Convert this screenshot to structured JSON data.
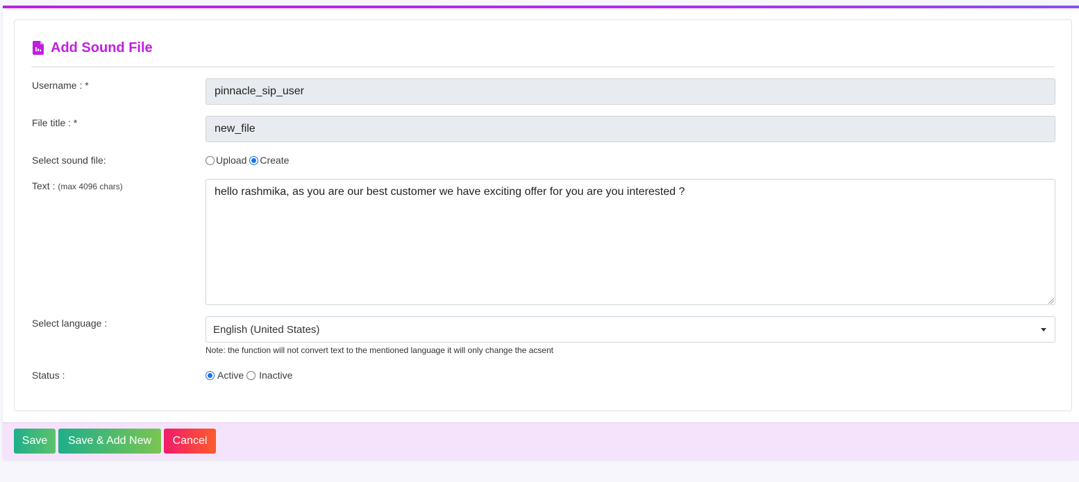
{
  "colors": {
    "accent": "#c11ee1",
    "footer_bg": "#f5e3fb",
    "save_btn": "#1fae8a",
    "cancel_btn": "#f01b6b",
    "radio": "#1a73e8"
  },
  "header": {
    "title": "Add Sound File",
    "icon": "audio-file-icon"
  },
  "form": {
    "username": {
      "label": "Username : *",
      "value": "pinnacle_sip_user"
    },
    "file_title": {
      "label": "File title : *",
      "value": "new_file"
    },
    "sound_file": {
      "label": "Select sound file:",
      "options": [
        {
          "label": "Upload",
          "checked": false
        },
        {
          "label": "Create",
          "checked": true
        }
      ]
    },
    "text": {
      "label": "Text : ",
      "hint": "(max 4096 chars)",
      "value": "hello rashmika, as you are our best customer we have exciting offer for you are you interested ?"
    },
    "language": {
      "label": "Select language :",
      "selected": "English (United States)",
      "note": "Note: the function will not convert text to the mentioned language it will only change the acsent"
    },
    "status": {
      "label": "Status :",
      "options": [
        {
          "label": "Active",
          "checked": true
        },
        {
          "label": "Inactive",
          "checked": false
        }
      ]
    }
  },
  "footer": {
    "save_label": "Save",
    "save_new_label": "Save & Add New",
    "cancel_label": "Cancel"
  }
}
